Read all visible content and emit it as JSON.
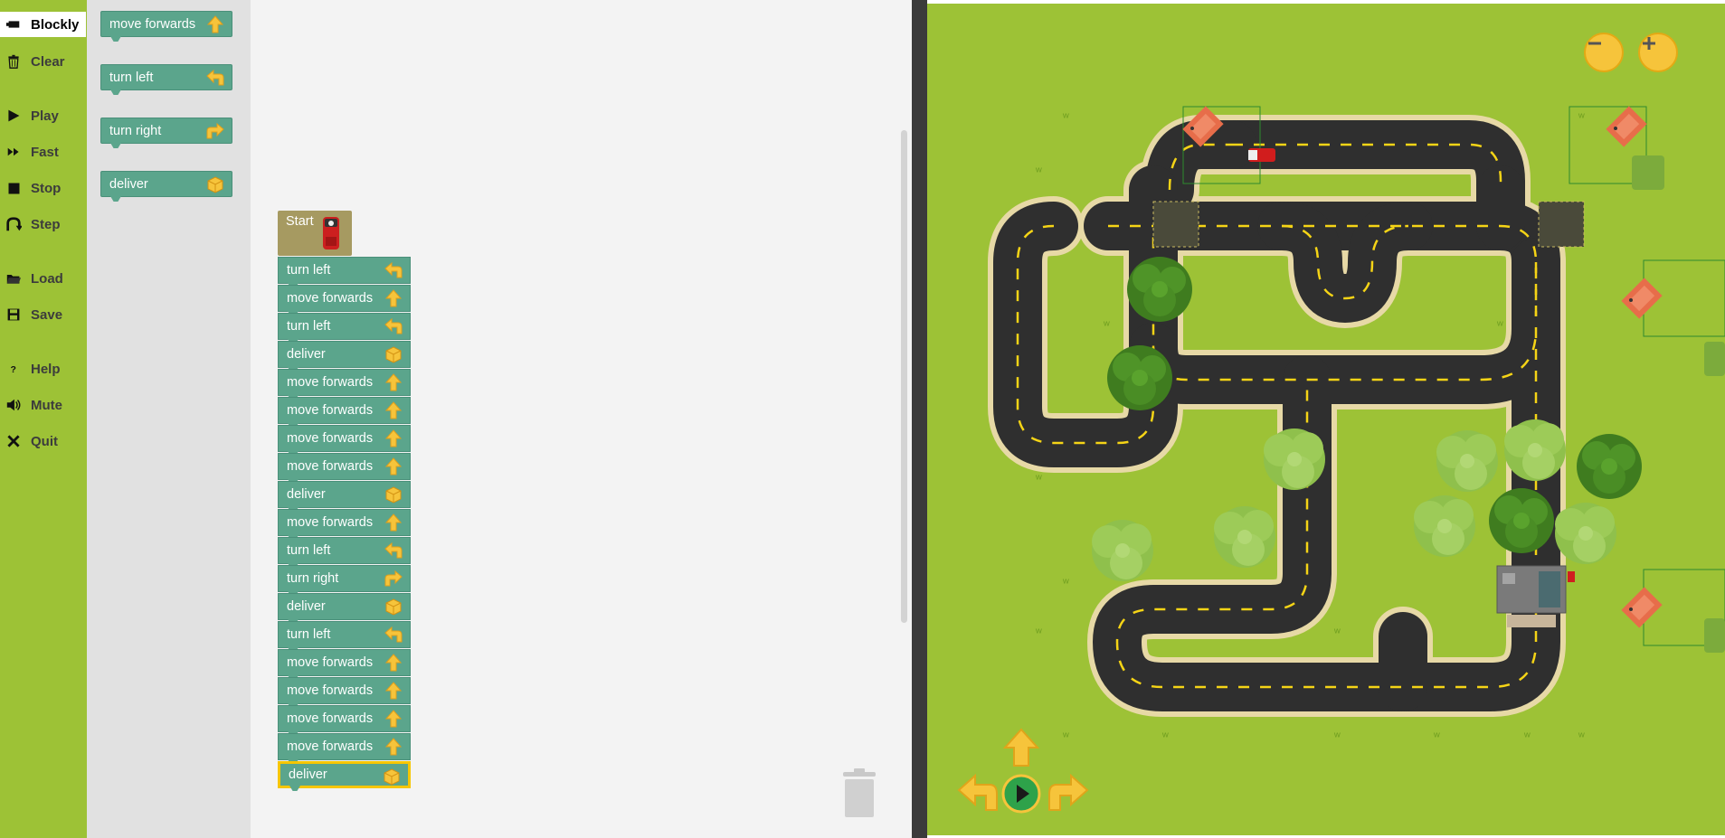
{
  "sidebar": {
    "items": [
      {
        "label": "Blockly",
        "icon": "blockly-icon",
        "active": true
      },
      {
        "label": "Clear",
        "icon": "trash-icon"
      },
      {
        "label": "Play",
        "icon": "play-icon"
      },
      {
        "label": "Fast",
        "icon": "fast-forward-icon"
      },
      {
        "label": "Stop",
        "icon": "stop-icon"
      },
      {
        "label": "Step",
        "icon": "step-icon"
      },
      {
        "label": "Load",
        "icon": "folder-icon"
      },
      {
        "label": "Save",
        "icon": "save-icon"
      },
      {
        "label": "Help",
        "icon": "help-icon"
      },
      {
        "label": "Mute",
        "icon": "speaker-icon"
      },
      {
        "label": "Quit",
        "icon": "close-icon"
      }
    ]
  },
  "toolbox": {
    "blocks": [
      {
        "label": "move forwards",
        "icon": "arrow-up-icon"
      },
      {
        "label": "turn left",
        "icon": "turn-left-icon"
      },
      {
        "label": "turn right",
        "icon": "turn-right-icon"
      },
      {
        "label": "deliver",
        "icon": "box-icon"
      }
    ]
  },
  "program": {
    "start_label": "Start",
    "blocks": [
      {
        "label": "turn left",
        "icon": "turn-left-icon"
      },
      {
        "label": "move forwards",
        "icon": "arrow-up-icon"
      },
      {
        "label": "turn left",
        "icon": "turn-left-icon"
      },
      {
        "label": "deliver",
        "icon": "box-icon"
      },
      {
        "label": "move forwards",
        "icon": "arrow-up-icon"
      },
      {
        "label": "move forwards",
        "icon": "arrow-up-icon"
      },
      {
        "label": "move forwards",
        "icon": "arrow-up-icon"
      },
      {
        "label": "move forwards",
        "icon": "arrow-up-icon"
      },
      {
        "label": "deliver",
        "icon": "box-icon"
      },
      {
        "label": "move forwards",
        "icon": "arrow-up-icon"
      },
      {
        "label": "turn left",
        "icon": "turn-left-icon"
      },
      {
        "label": "turn right",
        "icon": "turn-right-icon"
      },
      {
        "label": "deliver",
        "icon": "box-icon"
      },
      {
        "label": "turn left",
        "icon": "turn-left-icon"
      },
      {
        "label": "move forwards",
        "icon": "arrow-up-icon"
      },
      {
        "label": "move forwards",
        "icon": "arrow-up-icon"
      },
      {
        "label": "move forwards",
        "icon": "arrow-up-icon"
      },
      {
        "label": "move forwards",
        "icon": "arrow-up-icon"
      },
      {
        "label": "deliver",
        "icon": "box-icon",
        "selected": true
      }
    ]
  },
  "map": {
    "zoom_controls": [
      "zoom-out",
      "zoom-in"
    ],
    "direction_controls": [
      "forward",
      "left",
      "go",
      "right"
    ],
    "colors": {
      "grass": "#9dc236",
      "road": "#2f2f2f",
      "road_edge": "#e7d9a6",
      "lane": "#f5d416",
      "block": "#5ba58c",
      "start_block": "#a69a61"
    }
  }
}
